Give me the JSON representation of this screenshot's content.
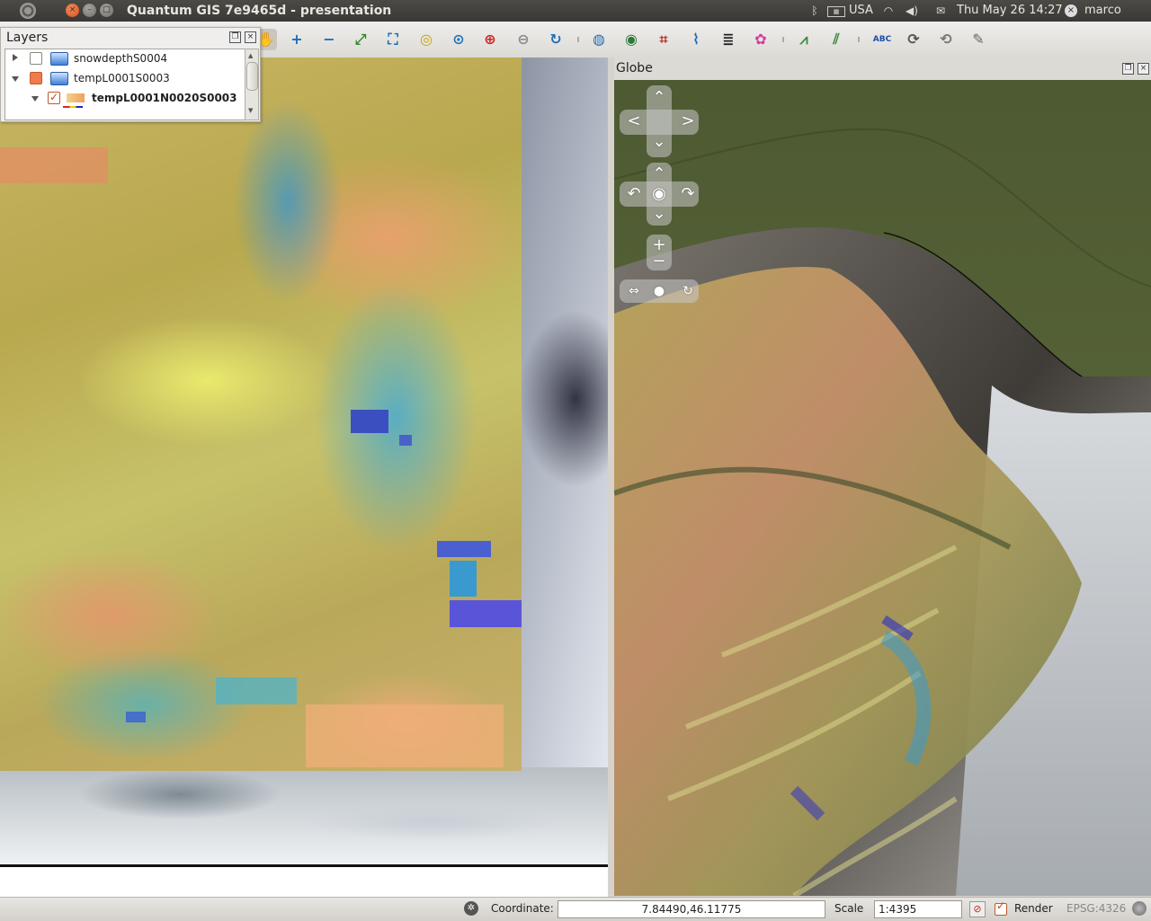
{
  "window": {
    "title": "Quantum GIS 7e9465d - presentation",
    "close_glyph": "×",
    "min_glyph": "–",
    "max_glyph": "□"
  },
  "system_tray": {
    "keyboard_layout": "USA",
    "datetime": "Thu May 26 14:27",
    "user": "marco",
    "icons": [
      "bluetooth-icon",
      "keyboard-icon",
      "wifi-icon",
      "volume-icon",
      "mail-icon",
      "power-icon"
    ]
  },
  "toolbar": {
    "tools": [
      {
        "name": "pan-tool",
        "glyph": "✋"
      },
      {
        "name": "zoom-in-tool",
        "glyph": "+"
      },
      {
        "name": "zoom-out-tool",
        "glyph": "−"
      },
      {
        "name": "zoom-full-tool",
        "glyph": "⤢"
      },
      {
        "name": "zoom-layer-tool",
        "glyph": "⛶"
      },
      {
        "name": "zoom-selection-tool",
        "glyph": "◎"
      },
      {
        "name": "zoom-native-tool",
        "glyph": "⊙"
      },
      {
        "name": "zoom-last-tool",
        "glyph": "⊕"
      },
      {
        "name": "zoom-next-tool",
        "glyph": "⊖"
      },
      {
        "name": "refresh-tool",
        "glyph": "↻"
      },
      {
        "name": "add-wms-tool",
        "glyph": "◍"
      },
      {
        "name": "globe-tool",
        "glyph": "◉"
      },
      {
        "name": "georeferencer-tool",
        "glyph": "⌗"
      },
      {
        "name": "gps-tool",
        "glyph": "⌇"
      },
      {
        "name": "layers-tool",
        "glyph": "≣"
      },
      {
        "name": "plugin-tool",
        "glyph": "✿"
      },
      {
        "name": "terrain-tool",
        "glyph": "⩘"
      },
      {
        "name": "histogram-tool",
        "glyph": "⫽"
      },
      {
        "name": "label-tool",
        "glyph": "ABC"
      },
      {
        "name": "move-label-tool",
        "glyph": "⟳"
      },
      {
        "name": "rotate-label-tool",
        "glyph": "⟲"
      },
      {
        "name": "change-label-tool",
        "glyph": "✎"
      }
    ]
  },
  "layers_panel": {
    "title": "Layers",
    "items": [
      {
        "label": "snowdepthS0004",
        "checked": false,
        "expanded": false
      },
      {
        "label": "tempL0001S0003",
        "checked": "partial",
        "expanded": true
      },
      {
        "label": "tempL0001N0020S0003",
        "checked": true,
        "expanded": true,
        "bold": true
      }
    ]
  },
  "globe_panel": {
    "title": "Globe"
  },
  "statusbar": {
    "coordinate_label": "Coordinate:",
    "coordinate_value": "7.84490,46.11775",
    "scale_label": "Scale",
    "scale_value": "1:4395",
    "render_label": "Render",
    "render_checked": true,
    "crs": "EPSG:4326"
  },
  "colors": {
    "title_bar": "#3c3b37",
    "close_button": "#e4612c",
    "checkbox_orange": "#f07c4a",
    "link_blue": "#2a5da5"
  }
}
